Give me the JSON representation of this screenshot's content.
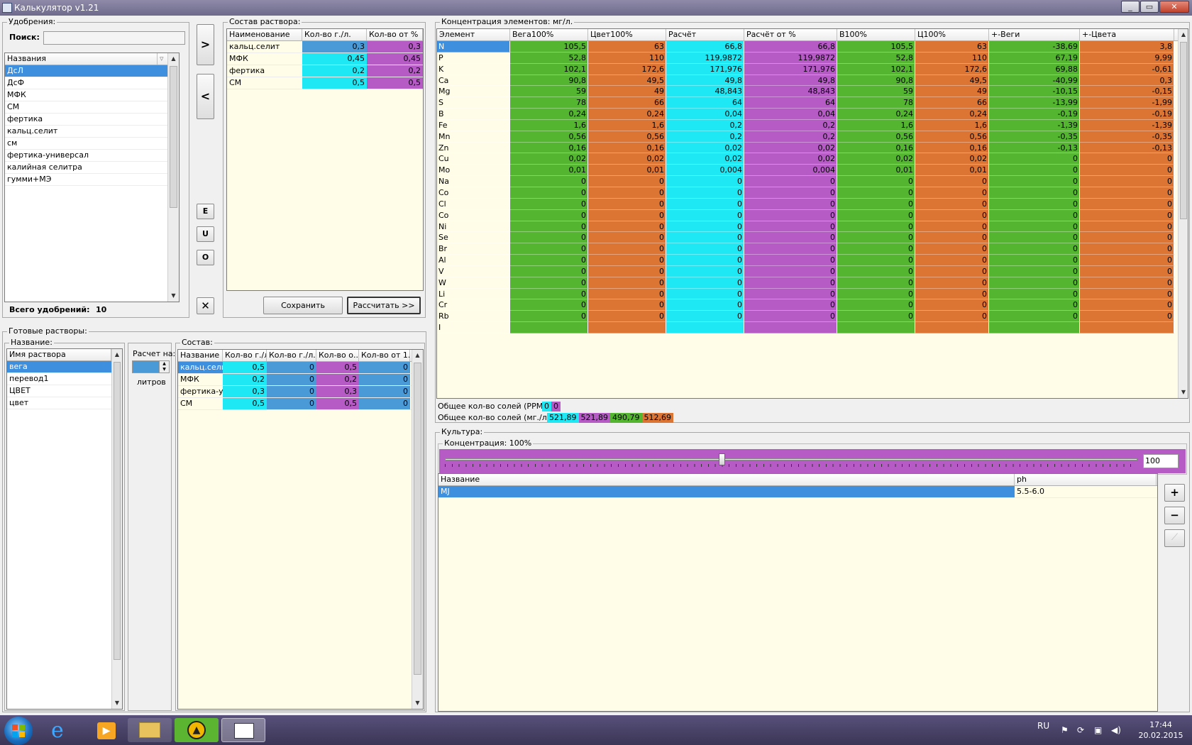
{
  "window": {
    "title": "Калькулятор v1.21"
  },
  "fertilizers": {
    "group_label": "Удобрения:",
    "search_label": "Поиск:",
    "search_value": "",
    "column": "Названия",
    "items": [
      "ДсЛ",
      "ДсФ",
      "МФК",
      "СМ",
      "фертика",
      "кальц.селит",
      "см",
      "фертика-универсал",
      "калийная селитра",
      "гумми+МЭ"
    ],
    "selected_index": 0,
    "total_label": "Всего удобрений:",
    "total_value": "10"
  },
  "transfer_buttons": {
    "add": ">",
    "remove": "<",
    "e": "E",
    "u": "U",
    "o": "O",
    "delete": "✕"
  },
  "solution_composition": {
    "group_label": "Состав раствора:",
    "columns": [
      "Наименование",
      "Кол-во г./л.",
      "Кол-во от %"
    ],
    "rows": [
      {
        "name": "кальц.селит",
        "qty": "0,3",
        "pct": "0,3"
      },
      {
        "name": "МФК",
        "qty": "0,45",
        "pct": "0,45"
      },
      {
        "name": "фертика",
        "qty": "0,2",
        "pct": "0,2"
      },
      {
        "name": "СМ",
        "qty": "0,5",
        "pct": "0,5"
      }
    ],
    "save_label": "Сохранить",
    "calc_label": "Рассчитать >>"
  },
  "ready_solutions": {
    "group_label": "Готовые растворы:",
    "name_group_label": "Название:",
    "column": "Имя раствора",
    "items": [
      "вега",
      "перевод1",
      "ЦВЕТ",
      "цвет"
    ],
    "selected_index": 0,
    "calc_for_label": "Расчет на:",
    "calc_for_value": "",
    "liters_label": "литров",
    "composition_group_label": "Состав:",
    "composition_columns": [
      "Название",
      "Кол-во г./л.",
      "Кол-во г./л.",
      "Кол-во о...",
      "Кол-во от 1..."
    ],
    "composition_rows": [
      {
        "name": "кальц.селит",
        "a": "0,5",
        "b": "0",
        "c": "0,5",
        "d": "0"
      },
      {
        "name": "МФК",
        "a": "0,2",
        "b": "0",
        "c": "0,2",
        "d": "0"
      },
      {
        "name": "фертика-уни",
        "a": "0,3",
        "b": "0",
        "c": "0,3",
        "d": "0"
      },
      {
        "name": "СМ",
        "a": "0,5",
        "b": "0",
        "c": "0,5",
        "d": "0"
      }
    ]
  },
  "concentration": {
    "group_label": "Концентрация элементов: мг/л.",
    "columns": [
      "Элемент",
      "Вега100%",
      "Цвет100%",
      "Расчёт",
      "Расчёт от %",
      "В100%",
      "Ц100%",
      "+-Веги",
      "+-Цвета"
    ],
    "rows": [
      [
        "N",
        "105,5",
        "63",
        "66,8",
        "66,8",
        "105,5",
        "63",
        "-38,69",
        "3,8"
      ],
      [
        "P",
        "52,8",
        "110",
        "119,9872",
        "119,9872",
        "52,8",
        "110",
        "67,19",
        "9,99"
      ],
      [
        "K",
        "102,1",
        "172,6",
        "171,976",
        "171,976",
        "102,1",
        "172,6",
        "69,88",
        "-0,61"
      ],
      [
        "Ca",
        "90,8",
        "49,5",
        "49,8",
        "49,8",
        "90,8",
        "49,5",
        "-40,99",
        "0,3"
      ],
      [
        "Mg",
        "59",
        "49",
        "48,843",
        "48,843",
        "59",
        "49",
        "-10,15",
        "-0,15"
      ],
      [
        "S",
        "78",
        "66",
        "64",
        "64",
        "78",
        "66",
        "-13,99",
        "-1,99"
      ],
      [
        "B",
        "0,24",
        "0,24",
        "0,04",
        "0,04",
        "0,24",
        "0,24",
        "-0,19",
        "-0,19"
      ],
      [
        "Fe",
        "1,6",
        "1,6",
        "0,2",
        "0,2",
        "1,6",
        "1,6",
        "-1,39",
        "-1,39"
      ],
      [
        "Mn",
        "0,56",
        "0,56",
        "0,2",
        "0,2",
        "0,56",
        "0,56",
        "-0,35",
        "-0,35"
      ],
      [
        "Zn",
        "0,16",
        "0,16",
        "0,02",
        "0,02",
        "0,16",
        "0,16",
        "-0,13",
        "-0,13"
      ],
      [
        "Cu",
        "0,02",
        "0,02",
        "0,02",
        "0,02",
        "0,02",
        "0,02",
        "0",
        "0"
      ],
      [
        "Mo",
        "0,01",
        "0,01",
        "0,004",
        "0,004",
        "0,01",
        "0,01",
        "0",
        "0"
      ],
      [
        "Na",
        "0",
        "0",
        "0",
        "0",
        "0",
        "0",
        "0",
        "0"
      ],
      [
        "Co",
        "0",
        "0",
        "0",
        "0",
        "0",
        "0",
        "0",
        "0"
      ],
      [
        "Cl",
        "0",
        "0",
        "0",
        "0",
        "0",
        "0",
        "0",
        "0"
      ],
      [
        "Co",
        "0",
        "0",
        "0",
        "0",
        "0",
        "0",
        "0",
        "0"
      ],
      [
        "Ni",
        "0",
        "0",
        "0",
        "0",
        "0",
        "0",
        "0",
        "0"
      ],
      [
        "Se",
        "0",
        "0",
        "0",
        "0",
        "0",
        "0",
        "0",
        "0"
      ],
      [
        "Br",
        "0",
        "0",
        "0",
        "0",
        "0",
        "0",
        "0",
        "0"
      ],
      [
        "Al",
        "0",
        "0",
        "0",
        "0",
        "0",
        "0",
        "0",
        "0"
      ],
      [
        "V",
        "0",
        "0",
        "0",
        "0",
        "0",
        "0",
        "0",
        "0"
      ],
      [
        "W",
        "0",
        "0",
        "0",
        "0",
        "0",
        "0",
        "0",
        "0"
      ],
      [
        "Li",
        "0",
        "0",
        "0",
        "0",
        "0",
        "0",
        "0",
        "0"
      ],
      [
        "Cr",
        "0",
        "0",
        "0",
        "0",
        "0",
        "0",
        "0",
        "0"
      ],
      [
        "Rb",
        "0",
        "0",
        "0",
        "0",
        "0",
        "0",
        "0",
        "0"
      ],
      [
        "I",
        "",
        "",
        "",
        "",
        "",
        "",
        "",
        ""
      ]
    ],
    "colors": [
      "#1ee8f4",
      "#54b531",
      "#dc7434",
      "#1ee8f4",
      "#b65bc6",
      "#54b531",
      "#dc7434",
      "#54b531",
      "#dc7434"
    ],
    "total_ppm_label": "Общее кол-во солей (PPM):",
    "total_ppm_values": [
      "0",
      "0"
    ],
    "total_mg_label": "Общее кол-во солей (мг./л.):",
    "total_mg_values": [
      "521,89",
      "521,89",
      "490,79",
      "512,69"
    ]
  },
  "culture": {
    "group_label": "Культура:",
    "conc_group_label": "Концентрация: 100%",
    "slider_value": "100",
    "slider_fraction": 0.4,
    "columns": [
      "Название",
      "ph"
    ],
    "rows": [
      {
        "name": "MJ",
        "ph": "5.5-6.0"
      }
    ],
    "add_label": "+",
    "remove_label": "−",
    "chart_label": "⟋"
  },
  "taskbar": {
    "lang": "RU",
    "time": "17:44",
    "date": "20.02.2015"
  }
}
